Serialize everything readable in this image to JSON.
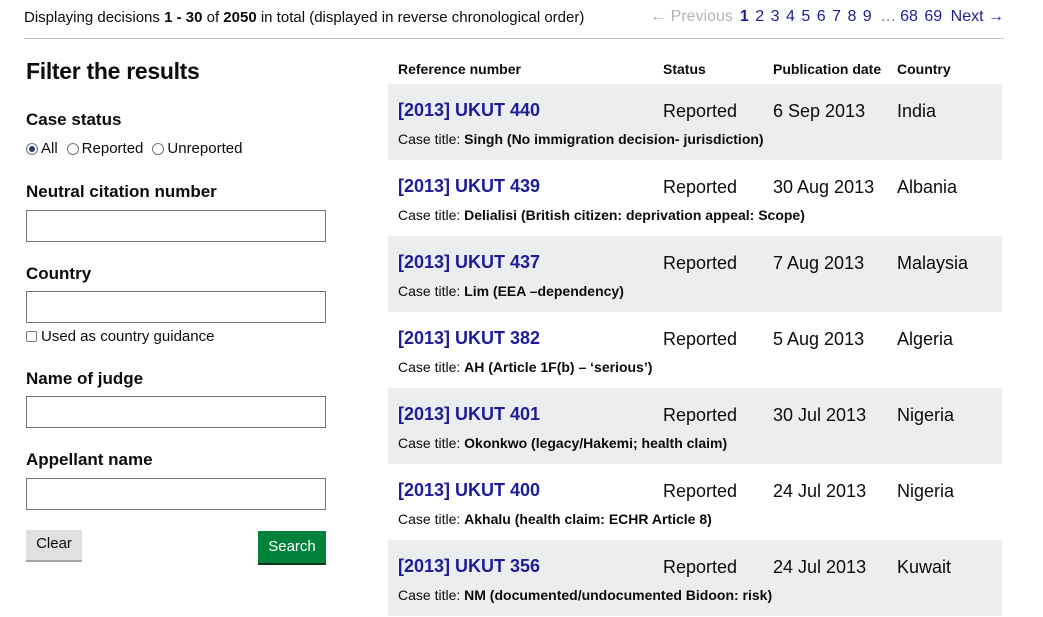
{
  "summary": {
    "prefix": "Displaying decisions ",
    "range": "1 - 30",
    "of": " of ",
    "total": "2050",
    "suffix": " in total (displayed in reverse chronological order)"
  },
  "pagination": {
    "previous": "← Previous",
    "pages": [
      "1",
      "2",
      "3",
      "4",
      "5",
      "6",
      "7",
      "8",
      "9"
    ],
    "ellipsis": "…",
    "last_pages": [
      "68",
      "69"
    ],
    "next": "Next →",
    "current": "1"
  },
  "filter": {
    "heading": "Filter the results",
    "case_status_label": "Case status",
    "status_options": [
      {
        "label": "All",
        "checked": true
      },
      {
        "label": "Reported",
        "checked": false
      },
      {
        "label": "Unreported",
        "checked": false
      }
    ],
    "neutral_citation_label": "Neutral citation number",
    "neutral_citation_value": "",
    "country_label": "Country",
    "country_value": "",
    "country_guidance_label": "Used as country guidance",
    "judge_label": "Name of judge",
    "judge_value": "",
    "appellant_label": "Appellant name",
    "appellant_value": "",
    "clear_label": "Clear",
    "search_label": "Search"
  },
  "table": {
    "headers": {
      "reference": "Reference number",
      "status": "Status",
      "date": "Publication date",
      "country": "Country"
    },
    "case_title_label": "Case title: ",
    "rows": [
      {
        "reference": "[2013] UKUT 440",
        "status": "Reported",
        "date": "6 Sep 2013",
        "country": "India",
        "title": "Singh (No immigration decision- jurisdiction)"
      },
      {
        "reference": "[2013] UKUT 439",
        "status": "Reported",
        "date": "30 Aug 2013",
        "country": "Albania",
        "title": "Delialisi (British citizen: deprivation appeal: Scope)"
      },
      {
        "reference": "[2013] UKUT 437",
        "status": "Reported",
        "date": "7 Aug 2013",
        "country": "Malaysia",
        "title": "Lim (EEA –dependency)"
      },
      {
        "reference": "[2013] UKUT 382",
        "status": "Reported",
        "date": "5 Aug 2013",
        "country": "Algeria",
        "title": "AH (Article 1F(b) – ‘serious’)"
      },
      {
        "reference": "[2013] UKUT 401",
        "status": "Reported",
        "date": "30 Jul 2013",
        "country": "Nigeria",
        "title": "Okonkwo (legacy/Hakemi; health claim)"
      },
      {
        "reference": "[2013] UKUT 400",
        "status": "Reported",
        "date": "24 Jul 2013",
        "country": "Nigeria",
        "title": "Akhalu (health claim: ECHR Article 8)"
      },
      {
        "reference": "[2013] UKUT 356",
        "status": "Reported",
        "date": "24 Jul 2013",
        "country": "Kuwait",
        "title": "NM (documented/undocumented Bidoon: risk)"
      }
    ]
  },
  "colors": {
    "link": "#1d1d9a",
    "row_shade": "#ebedef",
    "search_button": "#00823b",
    "clear_button": "#dee0e2"
  }
}
